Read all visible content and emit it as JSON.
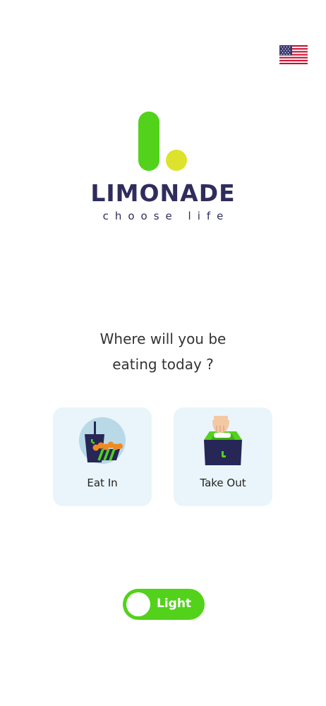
{
  "header": {
    "language_flag_icon": "us-flag-icon"
  },
  "brand": {
    "name": "LIMONADE",
    "tagline": "choose life",
    "colors": {
      "green": "#52d21b",
      "yellow": "#dde22c",
      "navy": "#2f2d5c"
    }
  },
  "prompt": {
    "line1": "Where will you be",
    "line2": "eating today ?"
  },
  "options": [
    {
      "label": "Eat In",
      "icon": "eat-in-icon"
    },
    {
      "label": "Take Out",
      "icon": "take-out-icon"
    }
  ],
  "theme_toggle": {
    "label": "Light",
    "state": "light"
  }
}
